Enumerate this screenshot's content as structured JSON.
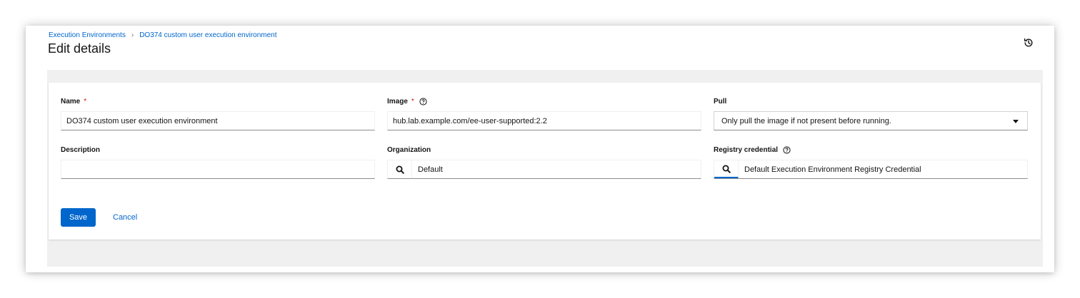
{
  "breadcrumb": {
    "items": [
      "Execution Environments",
      "DO374 custom user execution environment"
    ]
  },
  "page": {
    "title": "Edit details"
  },
  "form": {
    "name": {
      "label": "Name",
      "required_marker": "*",
      "value": "DO374 custom user execution environment"
    },
    "image": {
      "label": "Image",
      "required_marker": "*",
      "value": "hub.lab.example.com/ee-user-supported:2.2"
    },
    "pull": {
      "label": "Pull",
      "selected": "Only pull the image if not present before running."
    },
    "description": {
      "label": "Description",
      "value": ""
    },
    "organization": {
      "label": "Organization",
      "value": "Default"
    },
    "registry_credential": {
      "label": "Registry credential",
      "value": "Default Execution Environment Registry Credential"
    }
  },
  "actions": {
    "save_label": "Save",
    "cancel_label": "Cancel"
  },
  "icons": {
    "history": "history-icon",
    "help": "help-icon",
    "search": "search-icon",
    "caret": "caret-down-icon",
    "breadcrumb_separator": "chevron-right-icon"
  },
  "colors": {
    "link": "#0066cc",
    "primary_button": "#0066cc",
    "required": "#c9190b",
    "page_background": "#f0f0f0"
  }
}
